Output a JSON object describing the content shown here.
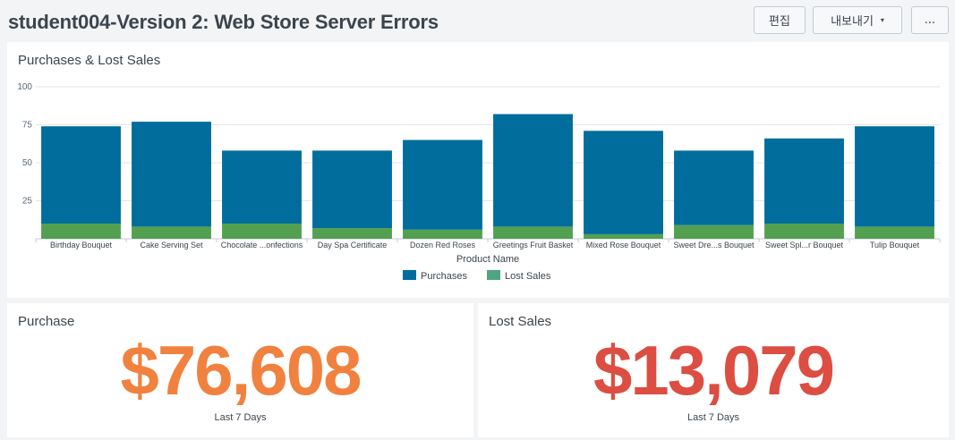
{
  "header": {
    "title": "student004-Version 2: Web Store Server Errors",
    "edit_label": "편집",
    "export_label": "내보내기",
    "more_label": "...",
    "export_caret": "▾"
  },
  "chart_panel": {
    "title": "Purchases & Lost Sales"
  },
  "chart_data": {
    "type": "bar",
    "stacked": true,
    "categories": [
      "Birthday Bouquet",
      "Cake Serving Set",
      "Chocolate ...onfections",
      "Day Spa Certificate",
      "Dozen Red Roses",
      "Greetings Fruit Basket",
      "Mixed Rose Bouquet",
      "Sweet Dre...s Bouquet",
      "Sweet Spl...r Bouquet",
      "Tulip Bouquet"
    ],
    "series": [
      {
        "name": "Lost Sales",
        "color": "#53a051",
        "values": [
          10,
          8,
          10,
          7,
          6,
          8,
          3,
          9,
          10,
          8
        ]
      },
      {
        "name": "Purchases",
        "color": "#006d9c",
        "values": [
          64,
          69,
          48,
          51,
          59,
          74,
          68,
          49,
          56,
          66
        ]
      }
    ],
    "legend_order": [
      "Purchases",
      "Lost Sales"
    ],
    "legend_colors": {
      "Purchases": "#006d9c",
      "Lost Sales": "#4fa484"
    },
    "xlabel": "Product Name",
    "ylabel": "",
    "ylim": [
      0,
      100
    ],
    "yticks": [
      25,
      50,
      75,
      100
    ],
    "grid": true,
    "legend_position": "bottom"
  },
  "single_values": [
    {
      "title": "Purchase",
      "value": "$76,608",
      "subtitle": "Last 7 Days",
      "color": "#f1813f"
    },
    {
      "title": "Lost Sales",
      "value": "$13,079",
      "subtitle": "Last 7 Days",
      "color": "#dc4e41"
    }
  ]
}
